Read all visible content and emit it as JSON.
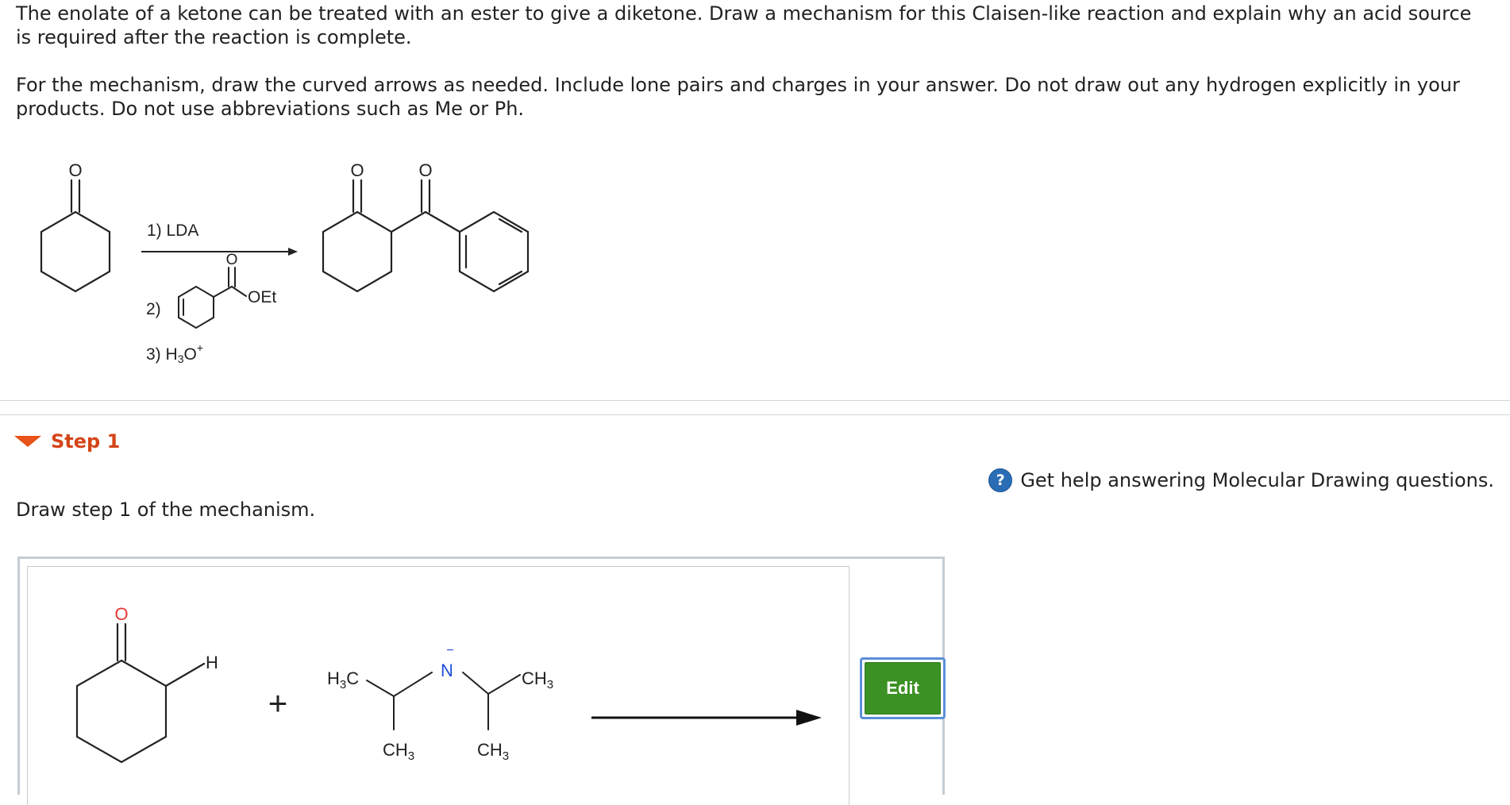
{
  "question": {
    "paragraph1": "The enolate of a ketone can be treated with an ester to give a diketone. Draw a mechanism for this Claisen-like reaction and explain why an acid source is required after the reaction is complete.",
    "paragraph2": "For the mechanism, draw the curved arrows as needed. Include lone pairs and charges in your answer.  Do not draw out any hydrogen explicitly in your products. Do not use abbreviations such as Me or Ph."
  },
  "scheme": {
    "reagent1": "1) LDA",
    "reagent2_prefix": "2)",
    "reagent2_group": "OEt",
    "reagent3_prefix": "3) H",
    "reagent3_sub": "3",
    "reagent3_suffix": "O",
    "reagent3_sup": "+",
    "oxygen": "O"
  },
  "step": {
    "title": "Step 1",
    "help_text": "Get help answering Molecular Drawing questions.",
    "help_icon": "?",
    "instruction": "Draw step 1 of the mechanism."
  },
  "canvas": {
    "oxygen": "O",
    "hydrogen": "H",
    "plus": "+",
    "h3c_prefix": "H",
    "h3c_sub": "3",
    "h3c_suffix": "C",
    "nitrogen": "N",
    "charge": "−",
    "ch3_prefix": "CH",
    "ch3_sub": "3"
  },
  "edit_button": {
    "label": "Edit"
  },
  "colors": {
    "step_title": "#d44417",
    "step_caret": "#e8531a",
    "edit_button": "#3c9124",
    "edit_focus_ring": "#5b8ed8",
    "help_icon": "#2a6db5",
    "oxygen_red": "#e53935",
    "nitrogen_blue": "#1e4fd8"
  }
}
